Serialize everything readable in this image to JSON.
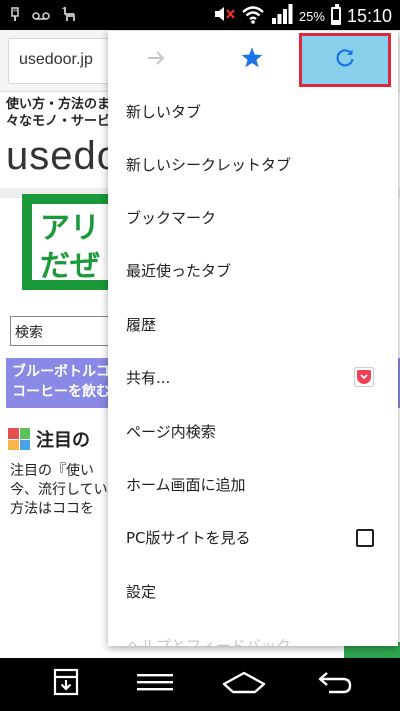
{
  "status_bar": {
    "left_icons": [
      "usb-icon",
      "voicemail-icon",
      "alpaca-icon"
    ],
    "battery_percent": "25%",
    "battery_level": 0.25,
    "time": "15:10"
  },
  "browser": {
    "url": "usedoor.jp"
  },
  "page": {
    "tagline_1": "使い方・方法のま",
    "tagline_2": "々なモノ・サービ",
    "site_logo": "usedo",
    "banner_line_1": "アリ",
    "banner_line_2": "だぜ",
    "search_value": "検索",
    "promo_line_1": "ブルーボトルコ",
    "promo_line_2": "コーヒーを飲む",
    "feature_title": "注目の",
    "para_line_1": "注目の『使い",
    "para_line_2": "今、流行してい",
    "para_line_3": "方法はココを"
  },
  "menu": {
    "top_icons": [
      "forward-icon",
      "bookmark-star-icon",
      "refresh-icon"
    ],
    "items": [
      {
        "label": "新しいタブ"
      },
      {
        "label": "新しいシークレットタブ"
      },
      {
        "label": "ブックマーク"
      },
      {
        "label": "最近使ったタブ"
      },
      {
        "label": "履歴"
      },
      {
        "label": "共有..."
      },
      {
        "label": "ページ内検索"
      },
      {
        "label": "ホーム画面に追加"
      },
      {
        "label": "PC版サイトを見る"
      },
      {
        "label": "設定"
      },
      {
        "label": "ヘルプとフィードバック"
      }
    ],
    "request_desktop_checked": false
  },
  "colors": {
    "highlight": "#87cfea",
    "highlight_border": "#e0283a",
    "star": "#1a73e8",
    "refresh": "#1a73e8"
  },
  "nav_bar": {
    "buttons": [
      "download-box-icon",
      "menu-lines-icon",
      "home-icon",
      "back-icon"
    ]
  }
}
